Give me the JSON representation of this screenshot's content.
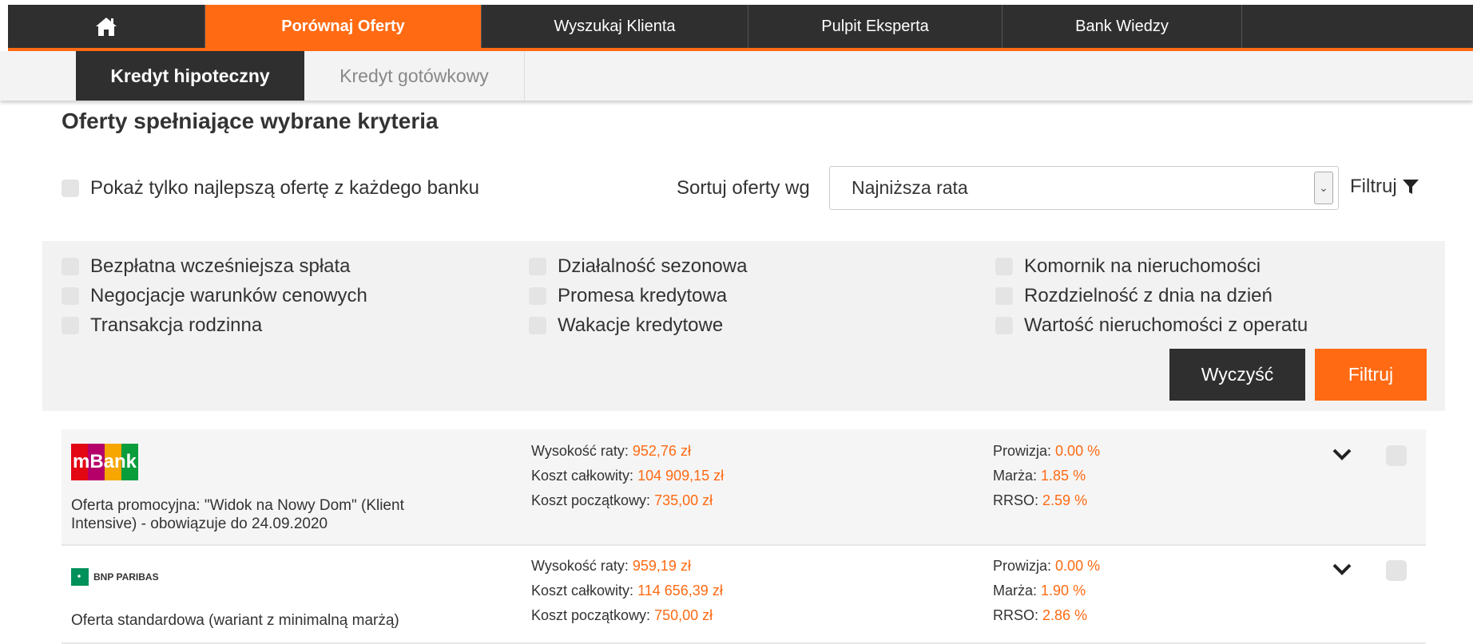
{
  "topnav": {
    "home_icon": "home-icon",
    "items": [
      "Porównaj Oferty",
      "Wyszukaj Klienta",
      "Pulpit Eksperta",
      "Bank Wiedzy"
    ]
  },
  "subnav": {
    "tabs": [
      "Kredyt hipoteczny",
      "Kredyt gotówkowy"
    ]
  },
  "page_title": "Oferty spełniające wybrane kryteria",
  "best_offer_label": "Pokaż tylko najlepszą ofertę z każdego banku",
  "sort": {
    "label": "Sortuj oferty wg",
    "value": "Najniższa rata"
  },
  "filter_link": "Filtruj",
  "filters": {
    "col1": [
      "Bezpłatna wcześniejsza spłata",
      "Negocjacje warunków cenowych",
      "Transakcja rodzinna"
    ],
    "col2": [
      "Działalność sezonowa",
      "Promesa kredytowa",
      "Wakacje kredytowe"
    ],
    "col3": [
      "Komornik na nieruchomości",
      "Rozdzielność z dnia na dzień",
      "Wartość nieruchomości z operatu"
    ]
  },
  "buttons": {
    "clear": "Wyczyść",
    "filter": "Filtruj"
  },
  "offers": [
    {
      "bank": "mBank",
      "description": "Oferta promocyjna: \"Widok na Nowy Dom\" (Klient Intensive) - obowiązuje do 24.09.2020",
      "rate_label": "Wysokość raty:",
      "rate": "952,76 zł",
      "total_label": "Koszt całkowity:",
      "total": "104 909,15 zł",
      "initial_label": "Koszt początkowy:",
      "initial": "735,00 zł",
      "commission_label": "Prowizja:",
      "commission": "0.00 %",
      "margin_label": "Marża:",
      "margin": "1.85 %",
      "rrso_label": "RRSO:",
      "rrso": "2.59 %"
    },
    {
      "bank": "BNP PARIBAS",
      "description": "Oferta standardowa (wariant z minimalną marżą)",
      "rate_label": "Wysokość raty:",
      "rate": "959,19 zł",
      "total_label": "Koszt całkowity:",
      "total": "114 656,39 zł",
      "initial_label": "Koszt początkowy:",
      "initial": "750,00 zł",
      "commission_label": "Prowizja:",
      "commission": "0.00 %",
      "margin_label": "Marża:",
      "margin": "1.90 %",
      "rrso_label": "RRSO:",
      "rrso": "2.86 %"
    }
  ],
  "colors": {
    "accent": "#ff6a13",
    "dark": "#2f2f2f",
    "panel": "#f2f2f2"
  }
}
